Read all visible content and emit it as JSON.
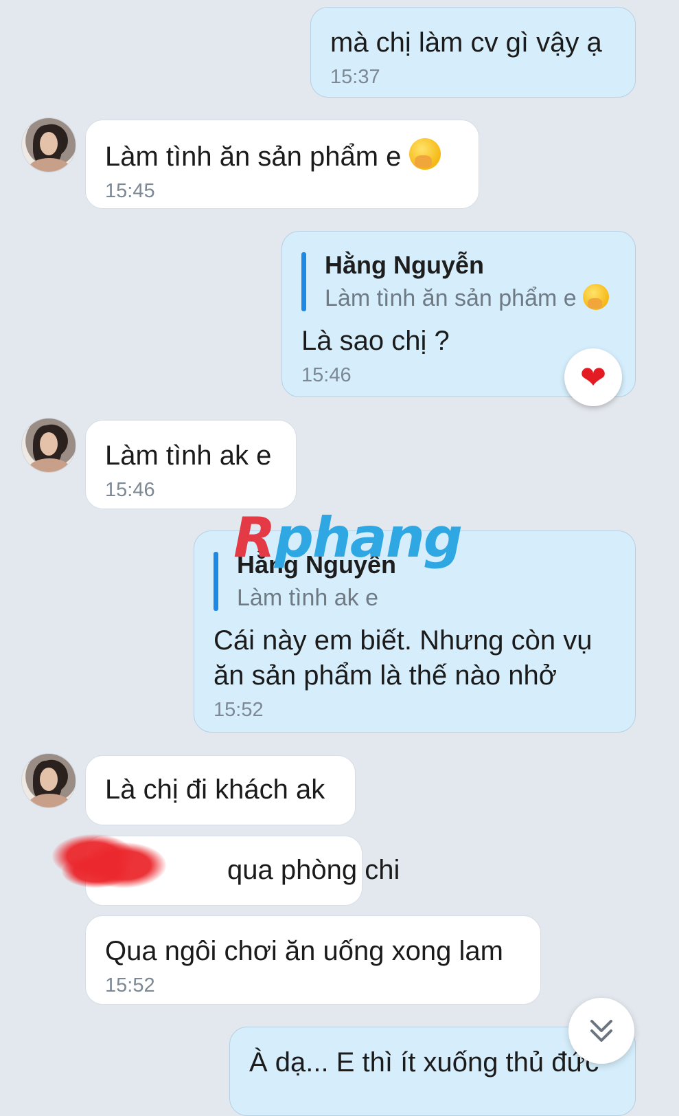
{
  "messages": [
    {
      "text": "mà chị làm cv gì vậy ạ",
      "time": "15:37"
    },
    {
      "text": "Làm tình ăn sản phẩm e",
      "emoji": "hand-over-mouth-emoji",
      "time": "15:45"
    },
    {
      "reply_to": {
        "name": "Hằng Nguyễn",
        "text": "Làm tình ăn sản phẩm e"
      },
      "text": "Là sao chị ?",
      "time": "15:46",
      "reaction": "❤"
    },
    {
      "text": "Làm tình ak e",
      "time": "15:46"
    },
    {
      "reply_to": {
        "name": "Hằng Nguyễn",
        "text": "Làm tình ak e"
      },
      "text": "Cái này em biết. Nhưng còn vụ ăn sản phẩm là thế nào nhở",
      "time": "15:52"
    },
    {
      "text": "Là chị đi khách ak"
    },
    {
      "text": "qua phòng chi"
    },
    {
      "text": "Qua ngôi chơi ăn uống xong lam",
      "time": "15:52"
    },
    {
      "text": "À dạ... E thì ít xuống thủ đức"
    }
  ],
  "watermark": {
    "part1": "R",
    "part2": "phang"
  },
  "colors": {
    "incoming": "#ffffff",
    "outgoing": "#d6eefc",
    "accent": "#1e88e5",
    "background": "#e3e8ee"
  }
}
